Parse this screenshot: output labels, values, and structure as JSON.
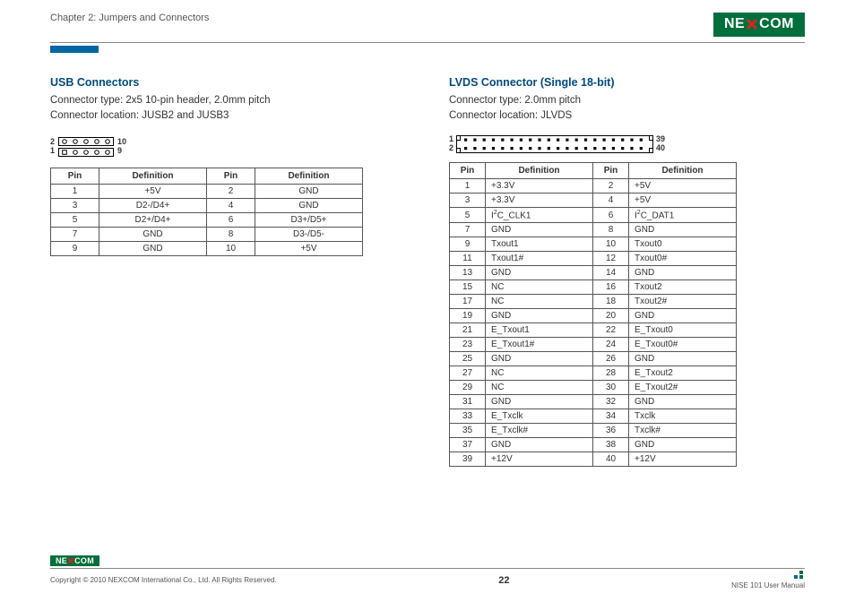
{
  "header": {
    "chapter": "Chapter 2: Jumpers and Connectors",
    "brand_pre": "NE",
    "brand_post": "COM"
  },
  "left": {
    "title": "USB Connectors",
    "line1": "Connector type: 2x5 10-pin header, 2.0mm pitch",
    "line2": "Connector location: JUSB2 and JUSB3",
    "pins": {
      "tl": "2",
      "bl": "1",
      "tr": "10",
      "br": "9"
    },
    "th": {
      "p1": "Pin",
      "d1": "Definition",
      "p2": "Pin",
      "d2": "Definition"
    },
    "rows": [
      {
        "p1": "1",
        "d1": "+5V",
        "p2": "2",
        "d2": "GND"
      },
      {
        "p1": "3",
        "d1": "D2-/D4+",
        "p2": "4",
        "d2": "GND"
      },
      {
        "p1": "5",
        "d1": "D2+/D4+",
        "p2": "6",
        "d2": "D3+/D5+"
      },
      {
        "p1": "7",
        "d1": "GND",
        "p2": "8",
        "d2": "D3-/D5-"
      },
      {
        "p1": "9",
        "d1": "GND",
        "p2": "10",
        "d2": "+5V"
      }
    ]
  },
  "right": {
    "title": "LVDS Connector (Single 18-bit)",
    "line1": "Connector type: 2.0mm pitch",
    "line2": "Connector location: JLVDS",
    "pins": {
      "tl": "1",
      "bl": "2",
      "tr": "39",
      "br": "40"
    },
    "th": {
      "p1": "Pin",
      "d1": "Definition",
      "p2": "Pin",
      "d2": "Definition"
    },
    "rows": [
      {
        "p1": "1",
        "d1": "+3.3V",
        "p2": "2",
        "d2": "+5V"
      },
      {
        "p1": "3",
        "d1": "+3.3V",
        "p2": "4",
        "d2": "+5V"
      },
      {
        "p1": "5",
        "d1": "I2C_CLK1",
        "p2": "6",
        "d2": "I2C_DAT1"
      },
      {
        "p1": "7",
        "d1": "GND",
        "p2": "8",
        "d2": "GND"
      },
      {
        "p1": "9",
        "d1": "Txout1",
        "p2": "10",
        "d2": "Txout0"
      },
      {
        "p1": "11",
        "d1": "Txout1#",
        "p2": "12",
        "d2": "Txout0#"
      },
      {
        "p1": "13",
        "d1": "GND",
        "p2": "14",
        "d2": "GND"
      },
      {
        "p1": "15",
        "d1": "NC",
        "p2": "16",
        "d2": "Txout2"
      },
      {
        "p1": "17",
        "d1": "NC",
        "p2": "18",
        "d2": "Txout2#"
      },
      {
        "p1": "19",
        "d1": "GND",
        "p2": "20",
        "d2": "GND"
      },
      {
        "p1": "21",
        "d1": "E_Txout1",
        "p2": "22",
        "d2": "E_Txout0"
      },
      {
        "p1": "23",
        "d1": "E_Txout1#",
        "p2": "24",
        "d2": "E_Txout0#"
      },
      {
        "p1": "25",
        "d1": "GND",
        "p2": "26",
        "d2": "GND"
      },
      {
        "p1": "27",
        "d1": "NC",
        "p2": "28",
        "d2": "E_Txout2"
      },
      {
        "p1": "29",
        "d1": "NC",
        "p2": "30",
        "d2": "E_Txout2#"
      },
      {
        "p1": "31",
        "d1": "GND",
        "p2": "32",
        "d2": "GND"
      },
      {
        "p1": "33",
        "d1": "E_Txclk",
        "p2": "34",
        "d2": "Txclk"
      },
      {
        "p1": "35",
        "d1": "E_Txclk#",
        "p2": "36",
        "d2": "Txclk#"
      },
      {
        "p1": "37",
        "d1": "GND",
        "p2": "38",
        "d2": "GND"
      },
      {
        "p1": "39",
        "d1": "+12V",
        "p2": "40",
        "d2": "+12V"
      }
    ]
  },
  "footer": {
    "copyright": "Copyright © 2010 NEXCOM International Co., Ltd. All Rights Reserved.",
    "page": "22",
    "manual": "NISE 101 User Manual",
    "brand_pre": "NE",
    "brand_post": "COM"
  }
}
